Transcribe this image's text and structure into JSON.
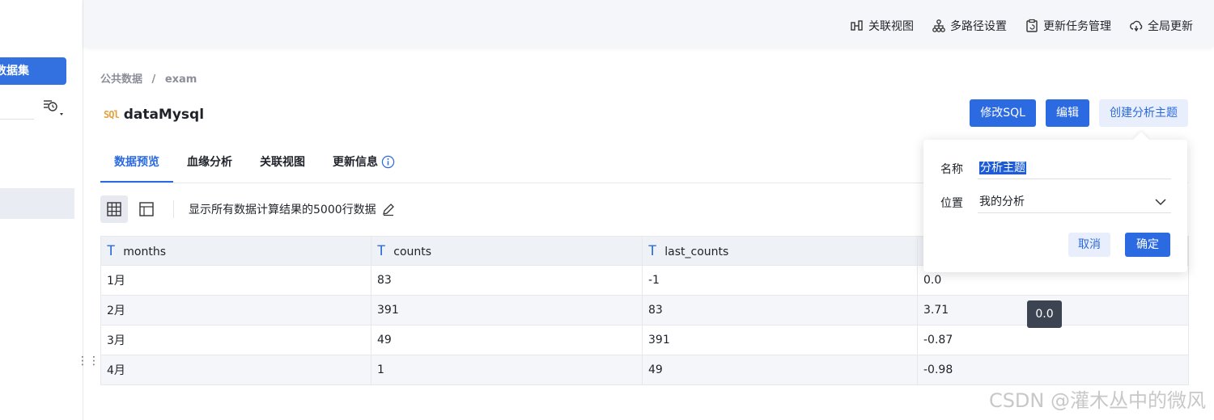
{
  "sidebar": {
    "dataset_button": "数据集",
    "drag_handle": "⋮⋮"
  },
  "header": {
    "actions": [
      {
        "label": "关联视图",
        "icon": "relation-view-icon"
      },
      {
        "label": "多路径设置",
        "icon": "multipath-icon"
      },
      {
        "label": "更新任务管理",
        "icon": "task-clipboard-icon"
      },
      {
        "label": "全局更新",
        "icon": "cloud-refresh-icon"
      }
    ]
  },
  "breadcrumb": {
    "root": "公共数据",
    "separator": "/",
    "current": "exam"
  },
  "dataset": {
    "type_icon": "SQl",
    "title": "dataMysql"
  },
  "actions": {
    "edit_sql": "修改SQL",
    "edit": "编辑",
    "create_topic": "创建分析主题"
  },
  "tabs": [
    {
      "label": "数据预览",
      "active": true
    },
    {
      "label": "血缘分析",
      "active": false
    },
    {
      "label": "关联视图",
      "active": false
    },
    {
      "label": "更新信息",
      "active": false
    }
  ],
  "toolbar": {
    "note": "显示所有数据计算结果的5000行数据"
  },
  "table": {
    "type_icon": "T",
    "columns": [
      "months",
      "counts",
      "last_counts",
      ""
    ],
    "rows": [
      [
        "1月",
        "83",
        "-1",
        "0.0"
      ],
      [
        "2月",
        "391",
        "83",
        "3.71"
      ],
      [
        "3月",
        "49",
        "391",
        "-0.87"
      ],
      [
        "4月",
        "1",
        "49",
        "-0.98"
      ]
    ]
  },
  "tooltip": {
    "text": "0.0"
  },
  "popover": {
    "name_label": "名称",
    "name_value": "分析主题",
    "location_label": "位置",
    "location_value": "我的分析",
    "cancel": "取消",
    "confirm": "确定"
  },
  "watermark": "CSDN @灌木丛中的微风",
  "colors": {
    "primary": "#2b6ae0",
    "light_primary": "#e8eefb",
    "header_bg": "#f5f6f9",
    "table_header_bg": "#eef1f6",
    "tooltip_bg": "#3c4452",
    "sql_icon": "#e6a23c"
  }
}
